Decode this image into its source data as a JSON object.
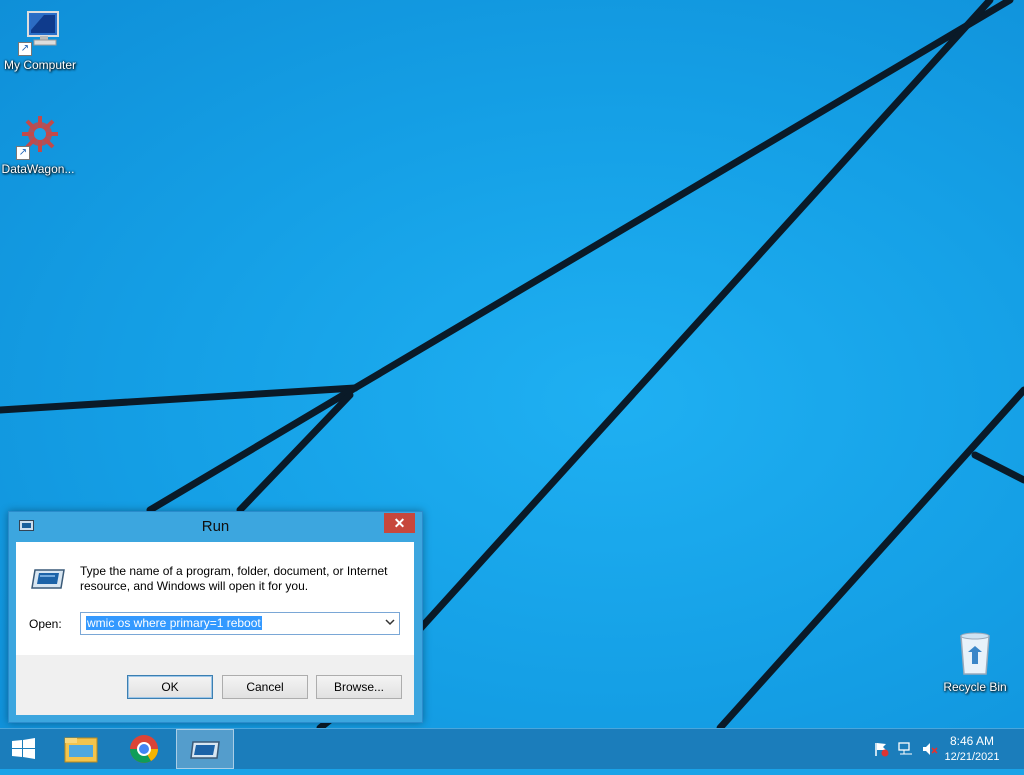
{
  "desktop": {
    "icons": [
      {
        "label": "My Computer",
        "icon": "computer-icon"
      },
      {
        "label": "DataWagon...",
        "icon": "datawagon-gear-icon"
      },
      {
        "label": "Recycle Bin",
        "icon": "recycle-bin-icon"
      }
    ]
  },
  "run_dialog": {
    "title": "Run",
    "close_label": "✕",
    "description": "Type the name of a program, folder, document, or Internet resource, and Windows will open it for you.",
    "open_label": "Open:",
    "command_value": "wmic os where primary=1 reboot",
    "buttons": {
      "ok": "OK",
      "cancel": "Cancel",
      "browse": "Browse..."
    }
  },
  "taskbar": {
    "apps": [
      "start-icon",
      "file-explorer-icon",
      "chrome-icon",
      "run-icon"
    ],
    "tray_icons": [
      "action-center-flag-icon",
      "network-icon",
      "volume-muted-icon"
    ],
    "clock": {
      "time": "8:46 AM",
      "date": "12/21/2021"
    }
  },
  "colors": {
    "desktop": "#1aa3e8",
    "taskbar": "#1b7dbb",
    "close": "#c7473c",
    "selection": "#3399ff"
  }
}
